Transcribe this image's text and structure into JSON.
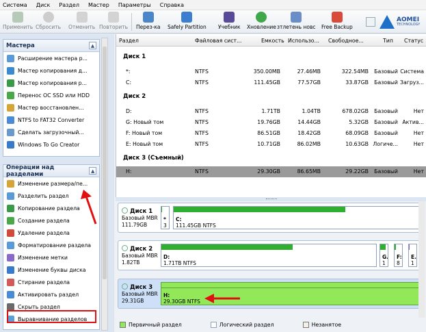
{
  "menu": [
    "Система",
    "Диск",
    "Раздел",
    "Мастер",
    "Параметры",
    "Справка"
  ],
  "toolbar": {
    "apply": "Применить",
    "discard": "Сбросить",
    "undo": "Отменить",
    "redo": "Повторить",
    "migrate": "Перез-ка",
    "safely_partition": "Safely Partition",
    "tutorial": "Учебник",
    "update": "Хновление",
    "news": "зтлетень новс",
    "free_backup": "Free Backup",
    "logo_main": "AOMEI",
    "logo_sub": "TECHNOLOGY"
  },
  "wizards": {
    "title": "Мастера",
    "items": [
      "Расширение мастера р...",
      "Мастер копирования д...",
      "Мастер копирования р...",
      "Перенос ОС SSD или HDD",
      "Мастер восстановлен...",
      "NTFS to FAT32 Converter",
      "Сделать загрузочный...",
      "Windows To Go Creator"
    ]
  },
  "operations": {
    "title": "Операции над разделами",
    "items": [
      "Изменение размера/пе...",
      "Разделить раздел",
      "Копирование раздела",
      "Создание раздела",
      "Удаление раздела",
      "Форматирование раздела",
      "Изменение метки",
      "Изменение буквы диска",
      "Стирание раздела",
      "Активировать раздел",
      "Скрыть раздел",
      "Выравнивание разделов"
    ]
  },
  "table": {
    "headers": [
      "Раздел",
      "Файловая сист...",
      "Емкость",
      "Использо...",
      "Свободное...",
      "Тип",
      "Статус"
    ],
    "groups": [
      {
        "title": "Диск 1",
        "rows": [
          [
            "*:",
            "NTFS",
            "350.00MB",
            "27.46MB",
            "322.54MB",
            "Базовый",
            "Система"
          ],
          [
            "C:",
            "NTFS",
            "111.45GB",
            "77.57GB",
            "33.87GB",
            "Базовый",
            "Загруз..."
          ]
        ]
      },
      {
        "title": "Диск 2",
        "rows": [
          [
            "D:",
            "NTFS",
            "1.71TB",
            "1.04TB",
            "678.02GB",
            "Базовый",
            "Нет"
          ],
          [
            "G: Новый том",
            "NTFS",
            "19.76GB",
            "14.44GB",
            "5.32GB",
            "Базовый",
            "Актив..."
          ],
          [
            "F: Новый том",
            "NTFS",
            "86.51GB",
            "18.42GB",
            "68.09GB",
            "Базовый",
            "Нет"
          ],
          [
            "E: Новый том",
            "NTFS",
            "10.71GB",
            "86.02MB",
            "10.63GB",
            "Логиче...",
            "Нет"
          ]
        ]
      },
      {
        "title": "Диск 3 (Съемный)",
        "rows": [
          [
            "H:",
            "NTFS",
            "29.30GB",
            "86.65MB",
            "29.22GB",
            "Базовый",
            "Нет"
          ]
        ]
      }
    ]
  },
  "disks": [
    {
      "name": "Диск 1",
      "type": "Базовый MBR",
      "size": "111.79GB",
      "parts": [
        {
          "label": "*",
          "sub": "3",
          "used": 0.08
        },
        {
          "label": "C:",
          "sub": "111.45GB NTFS",
          "used": 0.7
        }
      ]
    },
    {
      "name": "Диск 2",
      "type": "Базовый MBR",
      "size": "1.82TB",
      "parts": [
        {
          "label": "D:",
          "sub": "1.71TB NTFS",
          "used": 0.61
        },
        {
          "label": "G.",
          "sub": "1",
          "used": 0.73
        },
        {
          "label": "F:",
          "sub": "8",
          "used": 0.21
        },
        {
          "label": "E.",
          "sub": "1",
          "used": 0.01
        }
      ]
    },
    {
      "name": "Диск 3",
      "type": "Базовый MBR",
      "size": "29.31GB",
      "parts": [
        {
          "label": "H:",
          "sub": "29.30GB NTFS",
          "used": 0.003
        }
      ]
    }
  ],
  "legend": {
    "primary": "Первичный раздел",
    "logical": "Логический раздел",
    "unallocated": "Незанятое"
  },
  "colors": {
    "primary": "#2fae2f",
    "logical": "#7e6ed0",
    "selected_disk": "#93e85a",
    "annotation": "#e01010"
  }
}
